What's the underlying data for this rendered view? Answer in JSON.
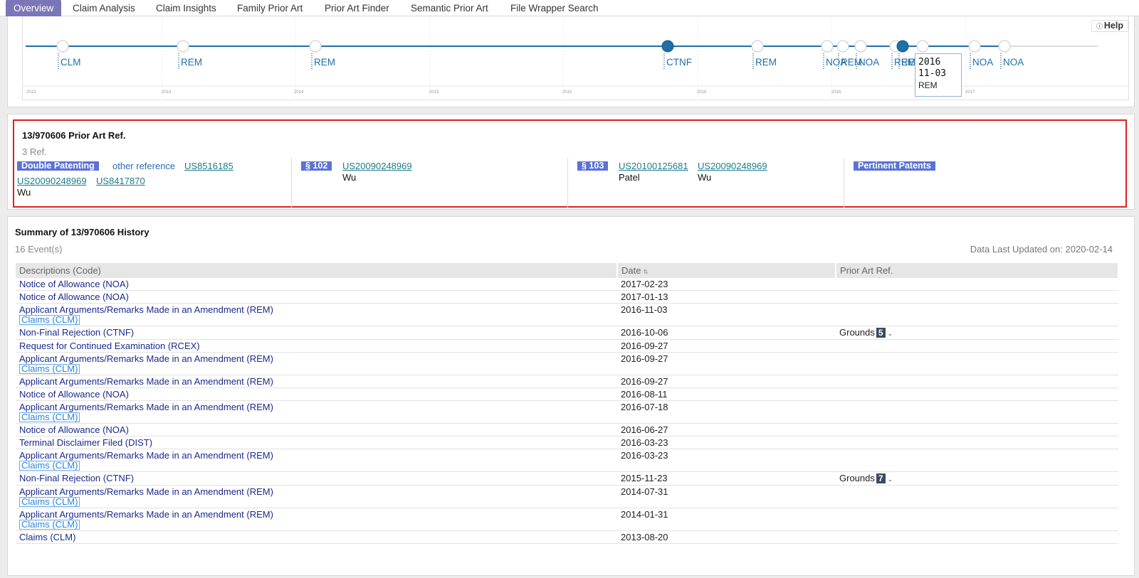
{
  "tabs": [
    {
      "label": "Overview",
      "active": true
    },
    {
      "label": "Claim Analysis"
    },
    {
      "label": "Claim Insights"
    },
    {
      "label": "Family Prior Art"
    },
    {
      "label": "Prior Art Finder"
    },
    {
      "label": "Semantic Prior Art"
    },
    {
      "label": "File Wrapper Search"
    }
  ],
  "timeline": {
    "help_label": "Help",
    "help_icon": "question-circle-icon",
    "events": [
      {
        "code": "CLM"
      },
      {
        "code": "REM"
      },
      {
        "code": "REM"
      },
      {
        "code": "CTNF",
        "highlight": true
      },
      {
        "code": "REM"
      },
      {
        "code": "NOA"
      },
      {
        "code": "REM"
      },
      {
        "code": "NOA"
      },
      {
        "code": "REM"
      },
      {
        "code": "REM",
        "highlight": true
      },
      {
        "code": "REM"
      },
      {
        "code": "NOA"
      },
      {
        "code": "NOA"
      }
    ],
    "years": [
      "2013",
      "2014",
      "2014",
      "2015",
      "2015",
      "2016",
      "2016",
      "2017"
    ],
    "tooltip": {
      "date_line1": "2016",
      "date_line2": "11-03",
      "code": "REM"
    },
    "accent": "#1f6fa8"
  },
  "prior_art": {
    "title": "13/970606 Prior Art Ref.",
    "count": "3 Ref.",
    "double_patenting": {
      "badge": "Double Patenting",
      "other_reference": "other reference",
      "refs": [
        "US8516185",
        "US20090248969",
        "US8417870"
      ],
      "inventor": "Wu"
    },
    "s102": {
      "badge": "§ 102",
      "refs": [
        {
          "number": "US20090248969",
          "inventor": "Wu"
        }
      ]
    },
    "s103": {
      "badge": "§ 103",
      "refs": [
        {
          "number": "US20100125681",
          "inventor": "Patel"
        },
        {
          "number": "US20090248969",
          "inventor": "Wu"
        }
      ]
    },
    "pertinent": {
      "badge": "Pertinent Patents"
    },
    "badge_color": "#5b72d6"
  },
  "summary": {
    "title": "Summary of 13/970606 History",
    "count": "16 Event(s)",
    "updated_label": "Data Last Updated on:",
    "updated_value": "2020-02-14",
    "columns": [
      "Descriptions (Code)",
      "Date",
      "Prior Art Ref."
    ],
    "rows": [
      {
        "desc": "Notice of Allowance (NOA)",
        "date": "2017-02-23"
      },
      {
        "desc": "Notice of Allowance (NOA)",
        "date": "2017-01-13"
      },
      {
        "desc": "Applicant Arguments/Remarks Made in an Amendment (REM)",
        "sub": "Claims (CLM)",
        "date": "2016-11-03"
      },
      {
        "desc": "Non-Final Rejection (CTNF)",
        "date": "2016-10-06",
        "grounds": "Grounds",
        "grounds_count": "5"
      },
      {
        "desc": "Request for Continued Examination (RCEX)",
        "date": "2016-09-27"
      },
      {
        "desc": "Applicant Arguments/Remarks Made in an Amendment (REM)",
        "sub": "Claims (CLM)",
        "date": "2016-09-27"
      },
      {
        "desc": "Applicant Arguments/Remarks Made in an Amendment (REM)",
        "date": "2016-09-27"
      },
      {
        "desc": "Notice of Allowance (NOA)",
        "date": "2016-08-11"
      },
      {
        "desc": "Applicant Arguments/Remarks Made in an Amendment (REM)",
        "sub": "Claims (CLM)",
        "date": "2016-07-18"
      },
      {
        "desc": "Notice of Allowance (NOA)",
        "date": "2016-06-27"
      },
      {
        "desc": "Terminal Disclaimer Filed (DIST)",
        "date": "2016-03-23"
      },
      {
        "desc": "Applicant Arguments/Remarks Made in an Amendment (REM)",
        "sub": "Claims (CLM)",
        "date": "2016-03-23"
      },
      {
        "desc": "Non-Final Rejection (CTNF)",
        "date": "2015-11-23",
        "grounds": "Grounds",
        "grounds_count": "7"
      },
      {
        "desc": "Applicant Arguments/Remarks Made in an Amendment (REM)",
        "sub": "Claims (CLM)",
        "date": "2014-07-31"
      },
      {
        "desc": "Applicant Arguments/Remarks Made in an Amendment (REM)",
        "sub": "Claims (CLM)",
        "date": "2014-01-31"
      },
      {
        "desc": "Claims (CLM)",
        "date": "2013-08-20"
      }
    ]
  }
}
